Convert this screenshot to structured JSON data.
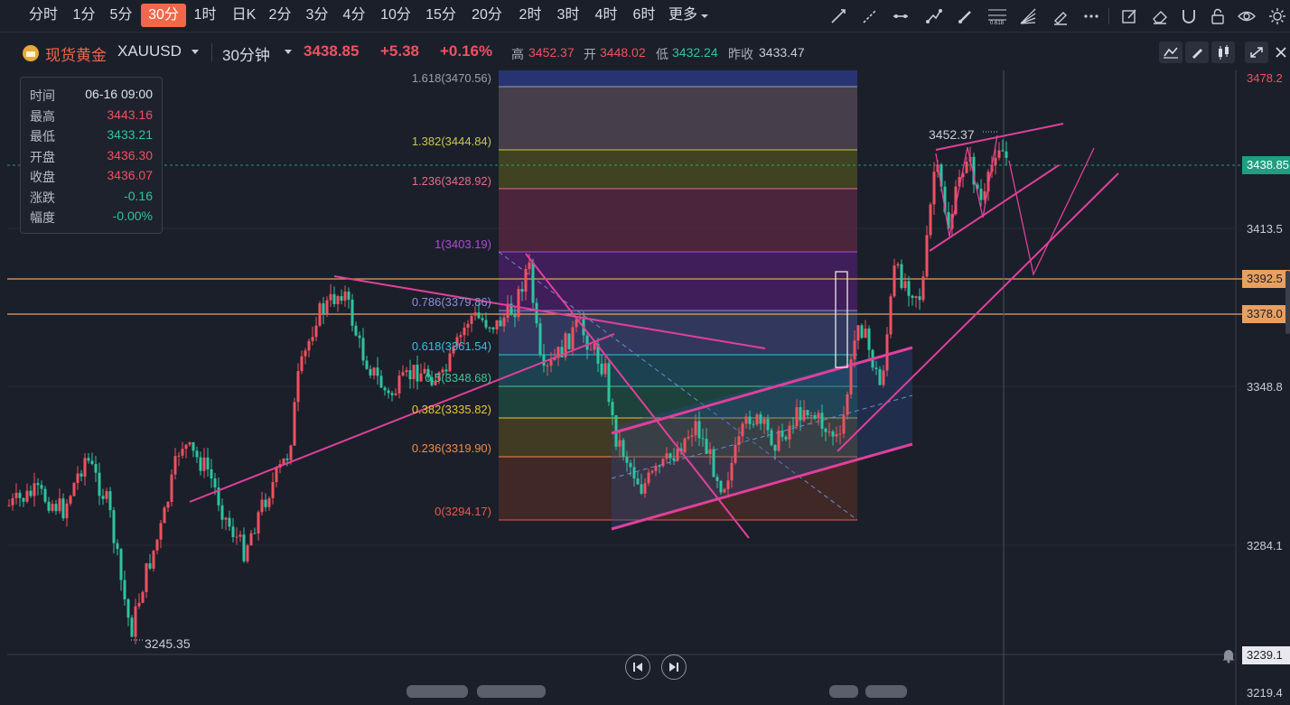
{
  "toolbar": {
    "timeframes": [
      "分时",
      "1分",
      "5分",
      "30分",
      "1时",
      "日K",
      "2分",
      "3分",
      "4分",
      "10分",
      "15分",
      "20分",
      "2时",
      "3时",
      "4时",
      "6时",
      "更多"
    ],
    "active_timeframe": "30分"
  },
  "header": {
    "symbol_name": "现货黄金",
    "symbol_code": "XAUUSD",
    "interval": "30分钟",
    "last_price": "3438.85",
    "change": "+5.38",
    "change_pct": "+0.16%",
    "high_label": "高",
    "high": "3452.37",
    "open_label": "开",
    "open": "3448.02",
    "low_label": "低",
    "low": "3432.24",
    "prev_close_label": "昨收",
    "prev_close": "3433.47"
  },
  "infobox": {
    "rows": [
      {
        "k": "时间",
        "v": "06-16 09:00"
      },
      {
        "k": "最高",
        "v": "3443.16"
      },
      {
        "k": "最低",
        "v": "3433.21"
      },
      {
        "k": "开盘",
        "v": "3436.30"
      },
      {
        "k": "收盘",
        "v": "3436.07"
      },
      {
        "k": "涨跌",
        "v": "-0.16"
      },
      {
        "k": "幅度",
        "v": "-0.00%"
      }
    ]
  },
  "price_axis": {
    "labels": [
      "3478.2",
      "3413.5",
      "3348.8",
      "3284.1",
      "3219.4"
    ],
    "current_tag": "3438.85",
    "level_tags": [
      "3392.5",
      "3378.0",
      "3239.1"
    ]
  },
  "fibonacci": {
    "levels": [
      {
        "label": "1.618(3470.56)",
        "color": "#9aa0ad"
      },
      {
        "label": "1.382(3444.84)",
        "color": "#c8c84a"
      },
      {
        "label": "1.236(3428.92)",
        "color": "#e86a8c"
      },
      {
        "label": "1(3403.19)",
        "color": "#b04bd6"
      },
      {
        "label": "0.786(3379.86)",
        "color": "#8d8fd9"
      },
      {
        "label": "0.618(3361.54)",
        "color": "#33c2e0"
      },
      {
        "label": "0.5(3348.68)",
        "color": "#3ec79a"
      },
      {
        "label": "0.382(3335.82)",
        "color": "#e6c53a"
      },
      {
        "label": "0.236(3319.90)",
        "color": "#f08a4b"
      },
      {
        "label": "0(3294.17)",
        "color": "#e85a4a"
      }
    ]
  },
  "annotations": {
    "high_marker": "3452.37",
    "low_marker": "3245.35"
  },
  "colors": {
    "up": "#f0515f",
    "down": "#2ec4a0",
    "accent": "#f0674a",
    "trendline": "#e0409a",
    "level_line": "#e8a060"
  },
  "icons": [
    "trend-line-icon",
    "ray-line-icon",
    "horizontal-line-icon",
    "polyline-icon",
    "brush-icon",
    "fibonacci-icon",
    "fan-icon",
    "pen-icon",
    "more-dots-icon",
    "edit-icon",
    "eraser-icon",
    "magnet-icon",
    "lock-icon",
    "eye-icon",
    "settings-icon"
  ]
}
